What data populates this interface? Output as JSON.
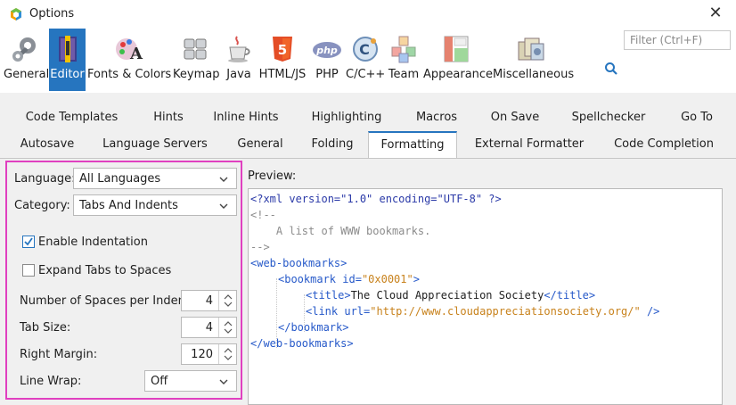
{
  "window": {
    "title": "Options",
    "close_glyph": "✕"
  },
  "toolbar": {
    "categories": [
      {
        "label": "General",
        "icon": "wrench-gear-icon"
      },
      {
        "label": "Editor",
        "icon": "editor-book-icon",
        "selected": true
      },
      {
        "label": "Fonts & Colors",
        "icon": "palette-icon"
      },
      {
        "label": "Keymap",
        "icon": "keyboard-icon"
      },
      {
        "label": "Java",
        "icon": "java-cup-icon"
      },
      {
        "label": "HTML/JS",
        "icon": "html5-icon"
      },
      {
        "label": "PHP",
        "icon": "php-icon"
      },
      {
        "label": "C/C++",
        "icon": "c-cpp-icon"
      },
      {
        "label": "Team",
        "icon": "team-cubes-icon"
      },
      {
        "label": "Appearance",
        "icon": "appearance-layout-icon"
      },
      {
        "label": "Miscellaneous",
        "icon": "misc-stamps-icon"
      }
    ],
    "search_placeholder": "Filter (Ctrl+F)"
  },
  "tabs": {
    "row1": [
      "Code Templates",
      "Hints",
      "Inline Hints",
      "Highlighting",
      "Macros",
      "On Save",
      "Spellchecker",
      "Go To"
    ],
    "row2": [
      "Autosave",
      "Language Servers",
      "General",
      "Folding",
      "Formatting",
      "External Formatter",
      "Code Completion"
    ],
    "active": "Formatting"
  },
  "form": {
    "language_label": "Language:",
    "language_value": "All Languages",
    "category_label": "Category:",
    "category_value": "Tabs And Indents",
    "enable_indentation_label": "Enable Indentation",
    "enable_indentation_checked": true,
    "expand_tabs_label": "Expand Tabs to Spaces",
    "expand_tabs_checked": false,
    "spaces_per_indent_label": "Number of Spaces per Indent:",
    "spaces_per_indent_value": "4",
    "tab_size_label": "Tab Size:",
    "tab_size_value": "4",
    "right_margin_label": "Right Margin:",
    "right_margin_value": "120",
    "line_wrap_label": "Line Wrap:",
    "line_wrap_value": "Off"
  },
  "preview": {
    "label": "Preview:",
    "lines": {
      "l1": "<?xml version=\"1.0\" encoding=\"UTF-8\" ?>",
      "l2": "<!--",
      "l3": "    A list of WWW bookmarks.",
      "l4": "-->",
      "l5_tag": "<web-bookmarks>",
      "l6_open": "<bookmark ",
      "l6_attr": "id",
      "l6_eq": "=",
      "l6_val": "\"0x0001\"",
      "l6_close": ">",
      "l7_open": "<title>",
      "l7_text": "The Cloud Appreciation Society",
      "l7_close": "</title>",
      "l8_open": "<link ",
      "l8_attr": "url",
      "l8_eq": "=",
      "l8_val": "\"http://www.cloudappreciationsociety.org/\"",
      "l8_close": " />",
      "l9": "</bookmark>",
      "l10": "</web-bookmarks>"
    }
  },
  "colors": {
    "accent": "#2675bf",
    "highlight_border": "#e040c0"
  }
}
